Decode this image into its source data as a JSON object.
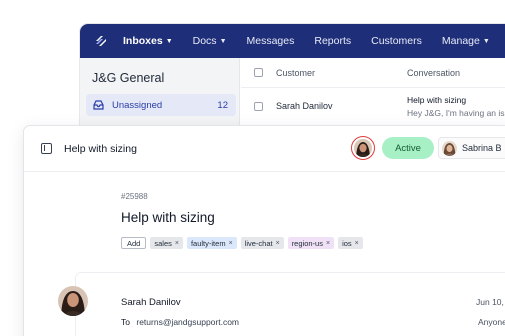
{
  "topnav": {
    "items": [
      {
        "label": "Inboxes",
        "caret": true
      },
      {
        "label": "Docs",
        "caret": true
      },
      {
        "label": "Messages",
        "caret": false
      },
      {
        "label": "Reports",
        "caret": false
      },
      {
        "label": "Customers",
        "caret": false
      },
      {
        "label": "Manage",
        "caret": true
      }
    ]
  },
  "sidebar": {
    "mailbox_title": "J&G General",
    "unassigned_label": "Unassigned",
    "unassigned_count": "12"
  },
  "table": {
    "col_customer": "Customer",
    "col_conversation": "Conversation",
    "row": {
      "customer": "Sarah Danilov",
      "subject": "Help with sizing",
      "preview": "Hey J&G, I'm having an iss"
    }
  },
  "conversation": {
    "header_title": "Help with sizing",
    "status": "Active",
    "assignee": "Sabrina B",
    "ticket_number": "#25988",
    "title": "Help with sizing",
    "add_tag_label": "Add",
    "tags": [
      {
        "label": "sales",
        "color": "#e5e7eb"
      },
      {
        "label": "faulty-item",
        "color": "#dbe8fb"
      },
      {
        "label": "live-chat",
        "color": "#e5e7eb"
      },
      {
        "label": "region-us",
        "color": "#f1e1f6"
      },
      {
        "label": "ios",
        "color": "#e5e7eb"
      }
    ],
    "tag_remove_glyph": "×",
    "message": {
      "sender": "Sarah Danilov",
      "to_label": "To",
      "to_address": "returns@jandgsupport.com",
      "date": "Jun 10,",
      "recipients": "Anyone"
    }
  },
  "colors": {
    "nav_bg": "#1e2e78",
    "status_active": "#a7f0c5",
    "viewer_ring": "#dc3b3b",
    "accent": "#2b3ea8"
  },
  "icons": {
    "logo": "brand-logo-icon",
    "inbox": "inbox-icon",
    "panel": "sidebar-toggle-icon",
    "caret": "chevron-down-icon"
  }
}
